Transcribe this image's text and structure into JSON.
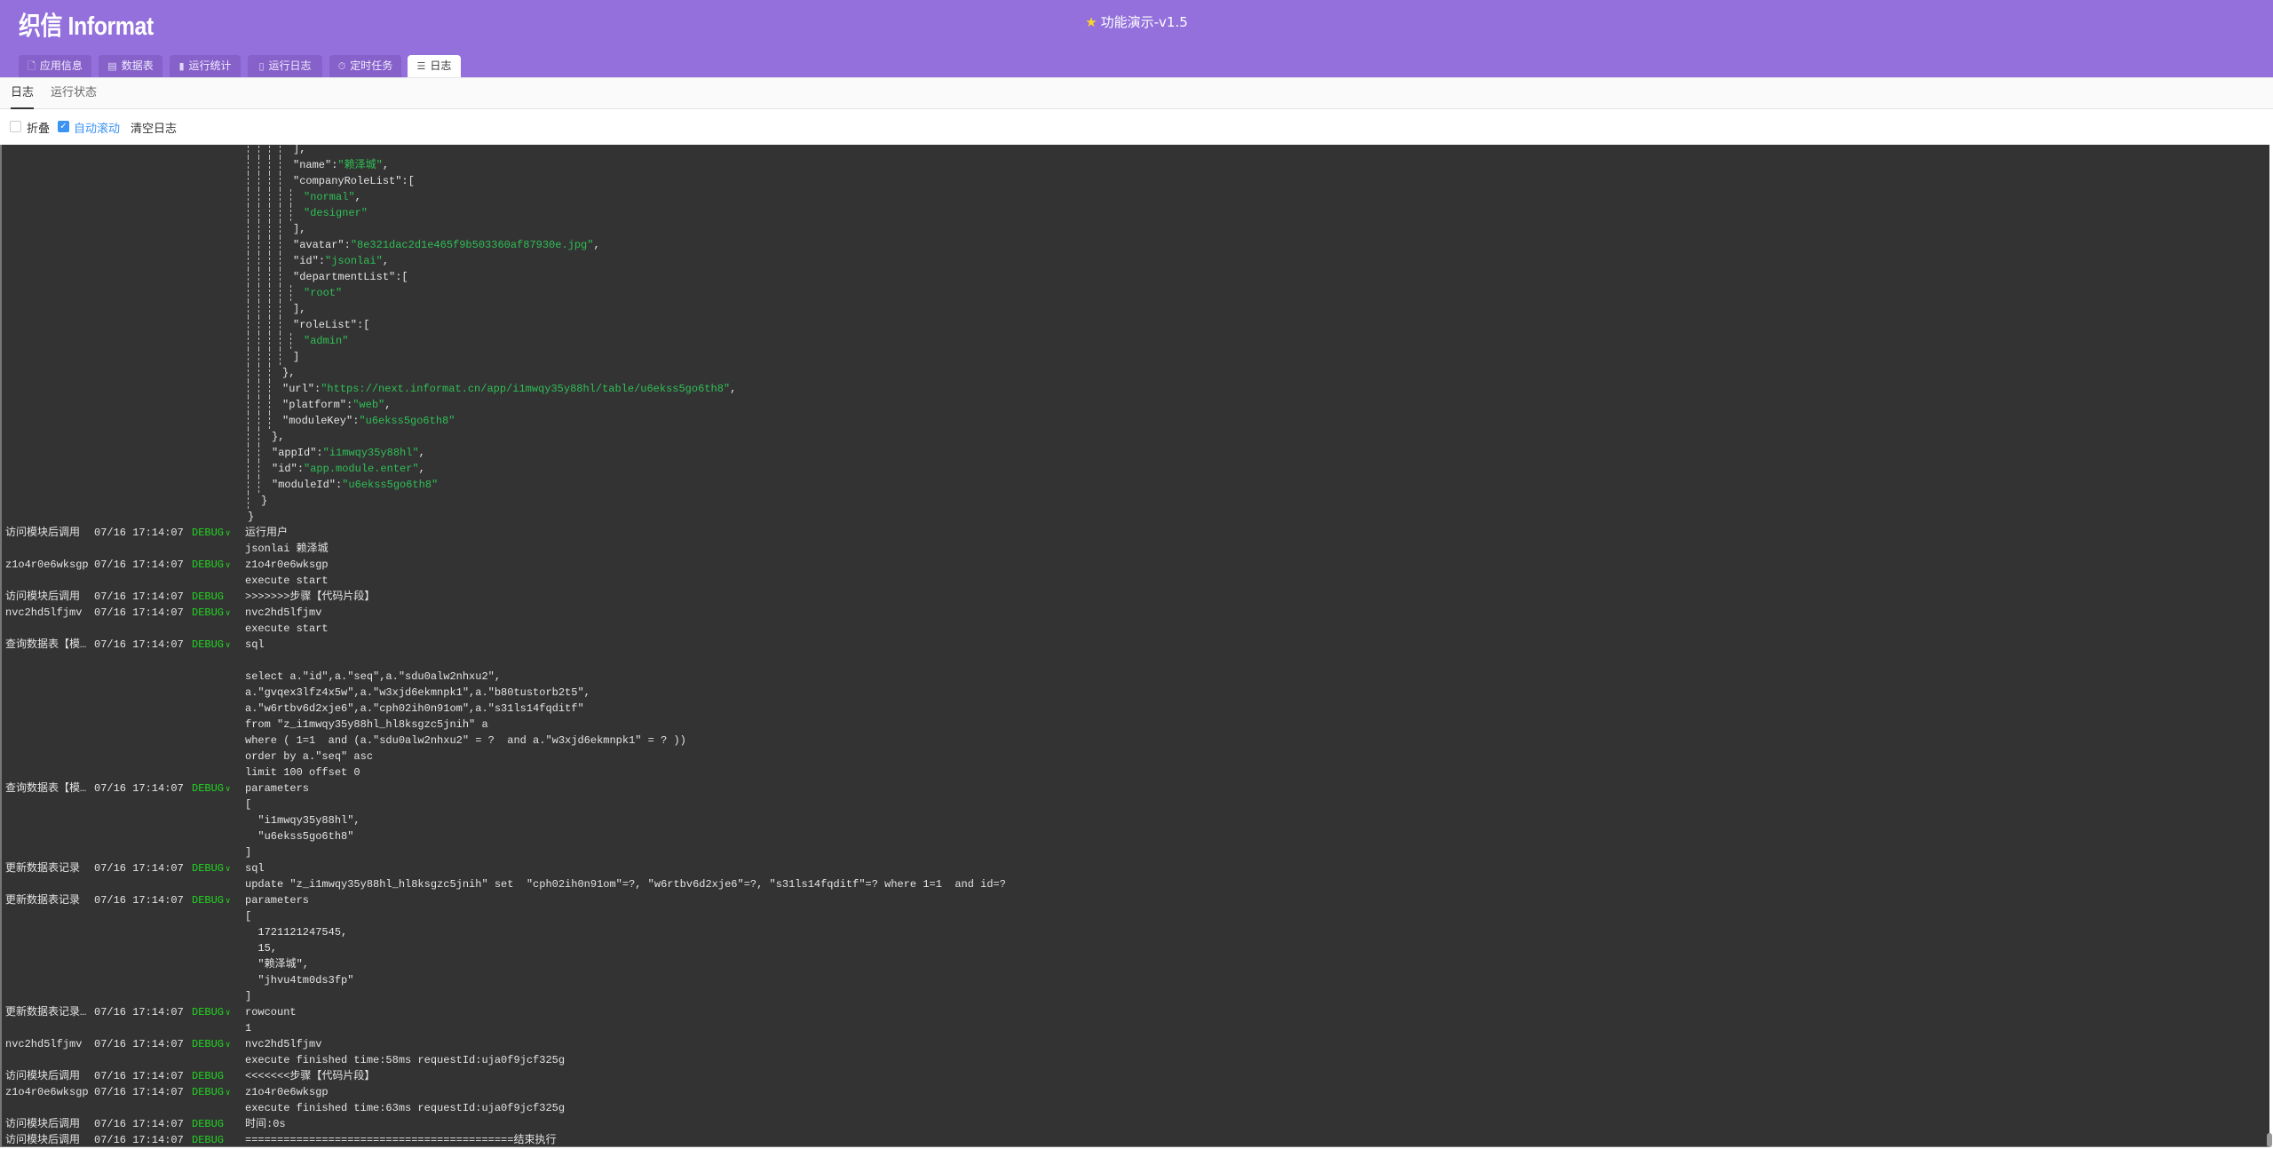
{
  "header": {
    "logo": "织信 Informat",
    "title": "功能演示-v1.5",
    "title_icon": "star-icon",
    "bg_color": "#9370db"
  },
  "tabs": [
    {
      "label": "应用信息",
      "icon": "file-icon",
      "glyph": "🗋"
    },
    {
      "label": "数据表",
      "icon": "table-icon",
      "glyph": "▤"
    },
    {
      "label": "运行统计",
      "icon": "bar-chart-icon",
      "glyph": "▮"
    },
    {
      "label": "运行日志",
      "icon": "document-icon",
      "glyph": "▯"
    },
    {
      "label": "定时任务",
      "icon": "stopwatch-icon",
      "glyph": "⏱"
    },
    {
      "label": "日志",
      "icon": "list-icon",
      "glyph": "☰",
      "active": true
    }
  ],
  "subtabs": [
    {
      "label": "日志",
      "active": true
    },
    {
      "label": "运行状态"
    }
  ],
  "toolbar": {
    "fold": {
      "label": "折叠",
      "checked": false
    },
    "autoscroll": {
      "label": "自动滚动",
      "checked": true
    },
    "clear_label": "清空日志"
  },
  "json_lines": [
    {
      "d": 4,
      "t": "],"
    },
    {
      "d": 4,
      "k": "\"name\"",
      "v": "\"赖泽城\"",
      "t": ","
    },
    {
      "d": 4,
      "k": "\"companyRoleList\"",
      "t": ":["
    },
    {
      "d": 5,
      "v": "\"normal\"",
      "t": ","
    },
    {
      "d": 5,
      "v": "\"designer\""
    },
    {
      "d": 4,
      "t": "],"
    },
    {
      "d": 4,
      "k": "\"avatar\"",
      "v": "\"8e321dac2d1e465f9b503360af87930e.jpg\"",
      "t": ","
    },
    {
      "d": 4,
      "k": "\"id\"",
      "v": "\"jsonlai\"",
      "t": ","
    },
    {
      "d": 4,
      "k": "\"departmentList\"",
      "t": ":["
    },
    {
      "d": 5,
      "v": "\"root\""
    },
    {
      "d": 4,
      "t": "],"
    },
    {
      "d": 4,
      "k": "\"roleList\"",
      "t": ":["
    },
    {
      "d": 5,
      "v": "\"admin\""
    },
    {
      "d": 4,
      "t": "]"
    },
    {
      "d": 3,
      "t": "},"
    },
    {
      "d": 3,
      "k": "\"url\"",
      "v": "\"https://next.informat.cn/app/i1mwqy35y88hl/table/u6ekss5go6th8\"",
      "t": ","
    },
    {
      "d": 3,
      "k": "\"platform\"",
      "v": "\"web\"",
      "t": ","
    },
    {
      "d": 3,
      "k": "\"moduleKey\"",
      "v": "\"u6ekss5go6th8\""
    },
    {
      "d": 2,
      "t": "},"
    },
    {
      "d": 2,
      "k": "\"appId\"",
      "v": "\"i1mwqy35y88hl\"",
      "t": ","
    },
    {
      "d": 2,
      "k": "\"id\"",
      "v": "\"app.module.enter\"",
      "t": ","
    },
    {
      "d": 2,
      "k": "\"moduleId\"",
      "v": "\"u6ekss5go6th8\""
    },
    {
      "d": 1,
      "t": "}"
    },
    {
      "d": 0,
      "t": "}"
    }
  ],
  "log_entries": [
    {
      "source": "访问模块后调用",
      "time": "07/16 17:14:07",
      "level": "DEBUG",
      "expand": true,
      "lines": [
        "运行用户",
        "jsonlai 赖泽城"
      ]
    },
    {
      "source": "z1o4r0e6wksgp",
      "time": "07/16 17:14:07",
      "level": "DEBUG",
      "expand": true,
      "lines": [
        "z1o4r0e6wksgp",
        "execute start"
      ]
    },
    {
      "source": "访问模块后调用",
      "time": "07/16 17:14:07",
      "level": "DEBUG",
      "expand": false,
      "lines": [
        ">>>>>>>步骤【代码片段】"
      ]
    },
    {
      "source": "nvc2hd5lfjmv",
      "time": "07/16 17:14:07",
      "level": "DEBUG",
      "expand": true,
      "lines": [
        "nvc2hd5lfjmv",
        "execute start"
      ]
    },
    {
      "source": "查询数据表【模…",
      "time": "07/16 17:14:07",
      "level": "DEBUG",
      "expand": true,
      "lines": [
        "sql",
        "",
        "select a.\"id\",a.\"seq\",a.\"sdu0alw2nhxu2\",",
        "a.\"gvqex3lfz4x5w\",a.\"w3xjd6ekmnpk1\",a.\"b80tustorb2t5\",",
        "a.\"w6rtbv6d2xje6\",a.\"cph02ih0n91om\",a.\"s31ls14fqditf\"",
        "from \"z_i1mwqy35y88hl_hl8ksgzc5jnih\" a",
        "where ( 1=1  and (a.\"sdu0alw2nhxu2\" = ?  and a.\"w3xjd6ekmnpk1\" = ? ))",
        "order by a.\"seq\" asc",
        "limit 100 offset 0"
      ]
    },
    {
      "source": "查询数据表【模…",
      "time": "07/16 17:14:07",
      "level": "DEBUG",
      "expand": true,
      "lines": [
        "parameters",
        "[",
        "  \"i1mwqy35y88hl\",",
        "  \"u6ekss5go6th8\"",
        "]"
      ]
    },
    {
      "source": "更新数据表记录",
      "time": "07/16 17:14:07",
      "level": "DEBUG",
      "expand": true,
      "lines": [
        "sql",
        "update \"z_i1mwqy35y88hl_hl8ksgzc5jnih\" set  \"cph02ih0n91om\"=?, \"w6rtbv6d2xje6\"=?, \"s31ls14fqditf\"=? where 1=1  and id=?"
      ]
    },
    {
      "source": "更新数据表记录",
      "time": "07/16 17:14:07",
      "level": "DEBUG",
      "expand": true,
      "lines": [
        "parameters",
        "[",
        "  1721121247545,",
        "  15,",
        "  \"赖泽城\",",
        "  \"jhvu4tm0ds3fp\"",
        "]"
      ]
    },
    {
      "source": "更新数据表记录…",
      "time": "07/16 17:14:07",
      "level": "DEBUG",
      "expand": true,
      "lines": [
        "rowcount",
        "1"
      ]
    },
    {
      "source": "nvc2hd5lfjmv",
      "time": "07/16 17:14:07",
      "level": "DEBUG",
      "expand": true,
      "lines": [
        "nvc2hd5lfjmv",
        "execute finished time:58ms requestId:uja0f9jcf325g"
      ]
    },
    {
      "source": "访问模块后调用",
      "time": "07/16 17:14:07",
      "level": "DEBUG",
      "expand": false,
      "lines": [
        "<<<<<<<步骤【代码片段】"
      ]
    },
    {
      "source": "z1o4r0e6wksgp",
      "time": "07/16 17:14:07",
      "level": "DEBUG",
      "expand": true,
      "lines": [
        "z1o4r0e6wksgp",
        "execute finished time:63ms requestId:uja0f9jcf325g"
      ]
    },
    {
      "source": "访问模块后调用",
      "time": "07/16 17:14:07",
      "level": "DEBUG",
      "expand": false,
      "lines": [
        "时间:0s"
      ]
    },
    {
      "source": "访问模块后调用",
      "time": "07/16 17:14:07",
      "level": "DEBUG",
      "expand": false,
      "lines": [
        "==========================================结束执行"
      ]
    }
  ],
  "colors": {
    "log_bg": "#333333",
    "debug": "#22d322",
    "string": "#2fbf55",
    "checkbox": "#3b93f2"
  }
}
